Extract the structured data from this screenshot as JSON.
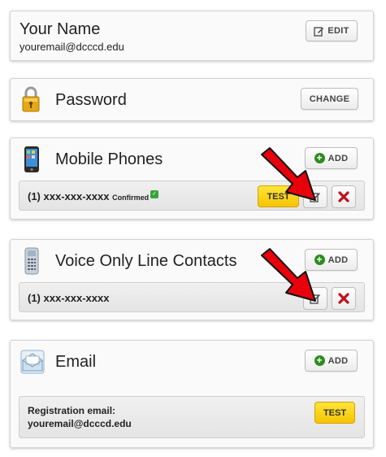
{
  "profile": {
    "name": "Your Name",
    "email": "youremail@dcccd.edu",
    "edit_label": "EDIT"
  },
  "password": {
    "title": "Password",
    "change_label": "CHANGE"
  },
  "mobile": {
    "title": "Mobile Phones",
    "add_label": "ADD",
    "number": "(1) xxx-xxx-xxxx",
    "status": "Confirmed",
    "test_label": "TEST"
  },
  "voice": {
    "title": "Voice Only Line Contacts",
    "add_label": "ADD",
    "number": "(1) xxx-xxx-xxxx"
  },
  "email": {
    "title": "Email",
    "add_label": "ADD",
    "reg_label": "Registration email:",
    "reg_value": "youremail@dcccd.edu",
    "test_label": "TEST"
  },
  "colors": {
    "test_yellow": "#f6c400",
    "add_green": "#2e8b20",
    "delete_red": "#c0101a",
    "arrow_red": "#e8000b"
  }
}
